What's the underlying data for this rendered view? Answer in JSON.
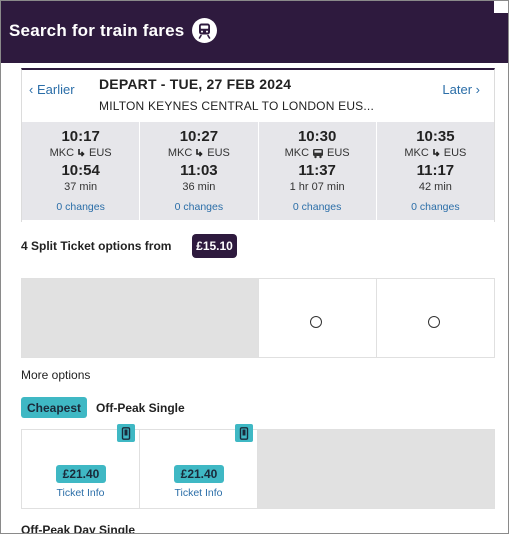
{
  "header": {
    "title": "Search for train fares",
    "icon": "train-icon",
    "brand_color": "#2e1a3e"
  },
  "journey": {
    "earlier_label": "Earlier",
    "later_label": "Later",
    "depart_heading": "DEPART - TUE, 27 FEB 2024",
    "route": "MILTON KEYNES CENTRAL TO LONDON EUS...",
    "times": [
      {
        "depart": "10:17",
        "from": "MKC",
        "to": "EUS",
        "mode": "down-arrow-icon",
        "arrive": "10:54",
        "duration": "37 min",
        "changes": "0 changes"
      },
      {
        "depart": "10:27",
        "from": "MKC",
        "to": "EUS",
        "mode": "down-arrow-icon",
        "arrive": "11:03",
        "duration": "36 min",
        "changes": "0 changes"
      },
      {
        "depart": "10:30",
        "from": "MKC",
        "to": "EUS",
        "mode": "bus-icon",
        "arrive": "11:37",
        "duration": "1 hr 07 min",
        "changes": "0 changes"
      },
      {
        "depart": "10:35",
        "from": "MKC",
        "to": "EUS",
        "mode": "down-arrow-icon",
        "arrive": "11:17",
        "duration": "42 min",
        "changes": "0 changes"
      }
    ]
  },
  "split": {
    "label": "4 Split Ticket options from",
    "price": "£15.10"
  },
  "more_options_label": "More options",
  "fare_section": {
    "cheapest_badge": "Cheapest",
    "ticket_type": "Off-Peak Single",
    "fares": [
      {
        "price": "£21.40",
        "info": "Ticket Info",
        "icon": "mobile-ticket-icon"
      },
      {
        "price": "£21.40",
        "info": "Ticket Info",
        "icon": "mobile-ticket-icon"
      }
    ]
  },
  "next_section_title": "Off-Peak Day Single",
  "colors": {
    "accent": "#3fb8c4",
    "link": "#2b6ea8",
    "grey": "#e1e1e1"
  }
}
